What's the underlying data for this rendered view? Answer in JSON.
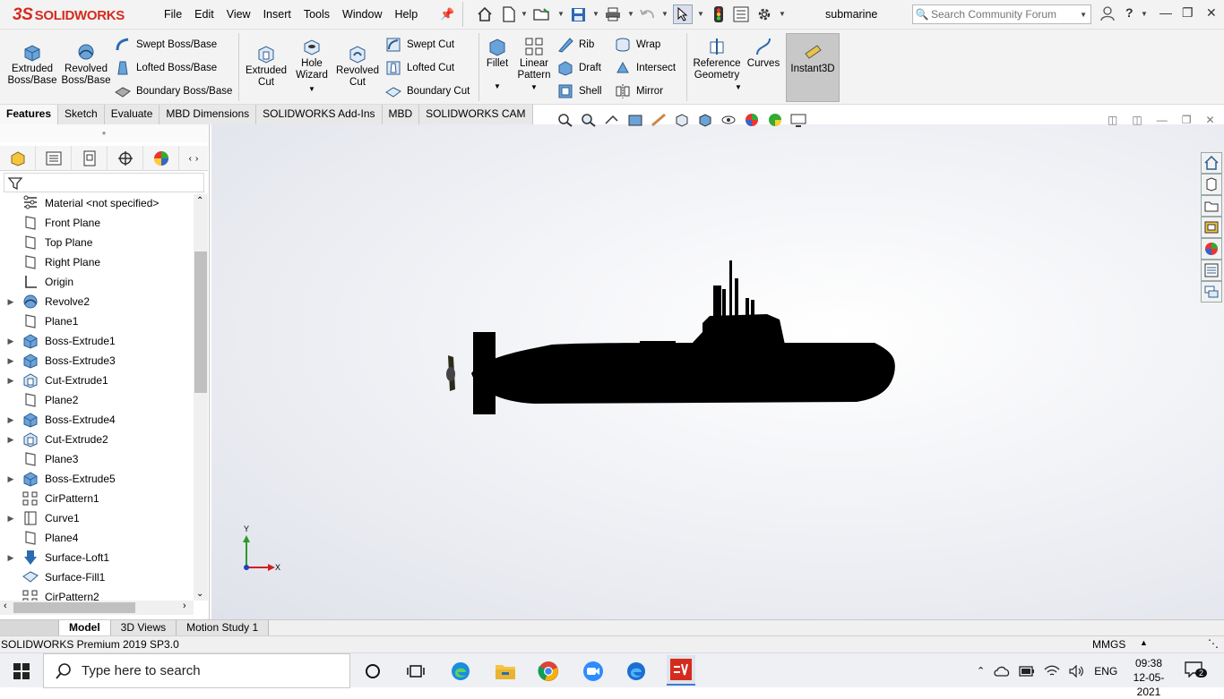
{
  "app": {
    "logo_ds": "3S",
    "logo_text": "SOLIDWORKS",
    "document_title": "submarine"
  },
  "menu": [
    "File",
    "Edit",
    "View",
    "Insert",
    "Tools",
    "Window",
    "Help"
  ],
  "search": {
    "placeholder": "Search Community Forum"
  },
  "ribbon": {
    "extruded_boss": "Extruded Boss/Base",
    "revolved_boss": "Revolved Boss/Base",
    "swept_boss": "Swept Boss/Base",
    "lofted_boss": "Lofted Boss/Base",
    "boundary_boss": "Boundary Boss/Base",
    "extruded_cut": "Extruded Cut",
    "hole_wizard": "Hole Wizard",
    "revolved_cut": "Revolved Cut",
    "swept_cut": "Swept Cut",
    "lofted_cut": "Lofted Cut",
    "boundary_cut": "Boundary Cut",
    "fillet": "Fillet",
    "linear_pattern": "Linear Pattern",
    "rib": "Rib",
    "draft": "Draft",
    "shell": "Shell",
    "wrap": "Wrap",
    "intersect": "Intersect",
    "mirror": "Mirror",
    "reference_geometry": "Reference Geometry",
    "curves": "Curves",
    "instant3d": "Instant3D"
  },
  "command_tabs": [
    "Features",
    "Sketch",
    "Evaluate",
    "MBD Dimensions",
    "SOLIDWORKS Add-Ins",
    "MBD",
    "SOLIDWORKS CAM"
  ],
  "tree": [
    {
      "label": "Material <not specified>",
      "expand": false,
      "icon": "material-icon"
    },
    {
      "label": "Front Plane",
      "expand": false,
      "icon": "plane-icon"
    },
    {
      "label": "Top Plane",
      "expand": false,
      "icon": "plane-icon"
    },
    {
      "label": "Right Plane",
      "expand": false,
      "icon": "plane-icon"
    },
    {
      "label": "Origin",
      "expand": false,
      "icon": "origin-icon"
    },
    {
      "label": "Revolve2",
      "expand": true,
      "icon": "revolve-icon"
    },
    {
      "label": "Plane1",
      "expand": false,
      "icon": "plane-icon"
    },
    {
      "label": "Boss-Extrude1",
      "expand": true,
      "icon": "extrude-icon"
    },
    {
      "label": "Boss-Extrude3",
      "expand": true,
      "icon": "extrude-icon"
    },
    {
      "label": "Cut-Extrude1",
      "expand": true,
      "icon": "cut-extrude-icon"
    },
    {
      "label": "Plane2",
      "expand": false,
      "icon": "plane-icon"
    },
    {
      "label": "Boss-Extrude4",
      "expand": true,
      "icon": "extrude-icon"
    },
    {
      "label": "Cut-Extrude2",
      "expand": true,
      "icon": "cut-extrude-icon"
    },
    {
      "label": "Plane3",
      "expand": false,
      "icon": "plane-icon"
    },
    {
      "label": "Boss-Extrude5",
      "expand": true,
      "icon": "extrude-icon"
    },
    {
      "label": "CirPattern1",
      "expand": false,
      "icon": "pattern-icon"
    },
    {
      "label": "Curve1",
      "expand": true,
      "icon": "curve-icon"
    },
    {
      "label": "Plane4",
      "expand": false,
      "icon": "plane-icon"
    },
    {
      "label": "Surface-Loft1",
      "expand": true,
      "icon": "surface-loft-icon"
    },
    {
      "label": "Surface-Fill1",
      "expand": false,
      "icon": "surface-fill-icon"
    },
    {
      "label": "CirPattern2",
      "expand": false,
      "icon": "pattern-icon"
    }
  ],
  "triad": {
    "y": "Y",
    "x": "X"
  },
  "bottom_tabs": [
    "Model",
    "3D Views",
    "Motion Study 1"
  ],
  "status": {
    "product": "SOLIDWORKS Premium 2019 SP3.0",
    "units": "MMGS"
  },
  "taskbar": {
    "search_placeholder": "Type here to search",
    "language": "ENG",
    "time": "09:38",
    "date": "12-05-2021",
    "notifications": "2"
  },
  "colors": {
    "brand_red": "#d52b1e",
    "icon_blue": "#2c6bb0",
    "model": "#000000"
  }
}
